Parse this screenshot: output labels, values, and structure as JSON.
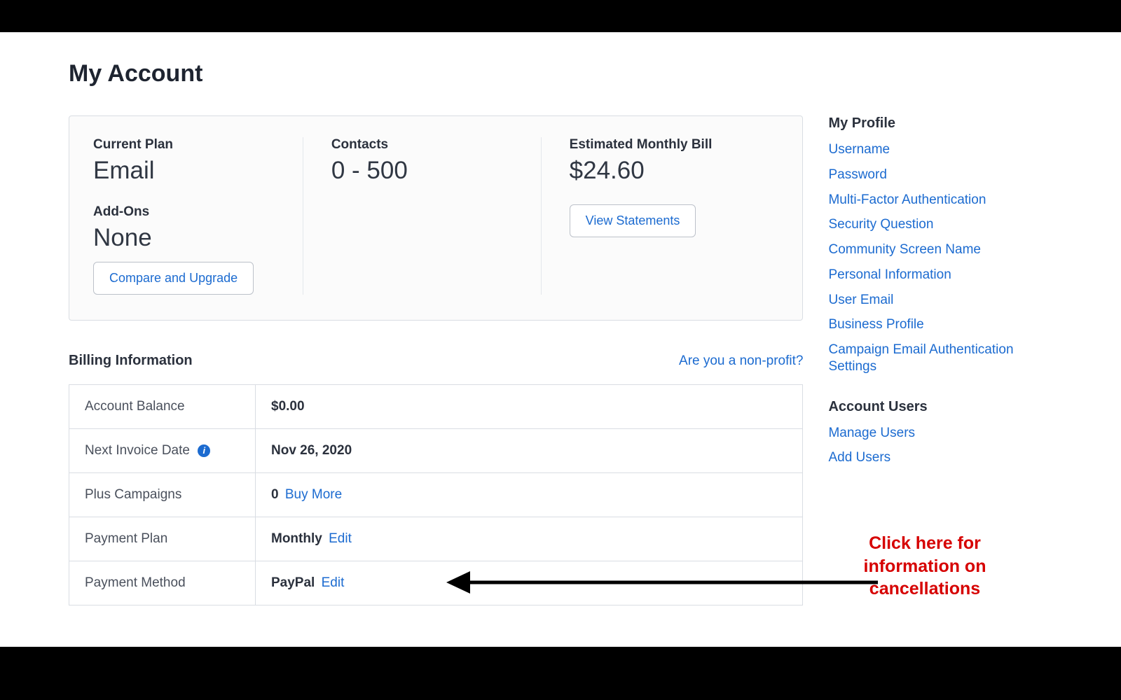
{
  "page": {
    "title": "My Account"
  },
  "plan": {
    "currentPlan": {
      "label": "Current Plan",
      "value": "Email"
    },
    "addOns": {
      "label": "Add-Ons",
      "value": "None"
    },
    "compareBtn": "Compare and Upgrade",
    "contacts": {
      "label": "Contacts",
      "value": "0 - 500"
    },
    "estimated": {
      "label": "Estimated Monthly Bill",
      "value": "$24.60"
    },
    "viewStatementsBtn": "View Statements"
  },
  "billing": {
    "heading": "Billing Information",
    "nonprofitLink": "Are you a non-profit?",
    "rows": {
      "accountBalance": {
        "key": "Account Balance",
        "value": "$0.00"
      },
      "nextInvoice": {
        "key": "Next Invoice Date",
        "value": "Nov 26, 2020"
      },
      "plusCampaigns": {
        "key": "Plus Campaigns",
        "count": "0",
        "link": "Buy More"
      },
      "paymentPlan": {
        "key": "Payment Plan",
        "value": "Monthly",
        "link": "Edit"
      },
      "paymentMethod": {
        "key": "Payment Method",
        "value": "PayPal",
        "link": "Edit"
      }
    }
  },
  "sidebar": {
    "profile": {
      "heading": "My Profile",
      "links": [
        "Username",
        "Password",
        "Multi-Factor Authentication",
        "Security Question",
        "Community Screen Name",
        "Personal Information",
        "User Email",
        "Business Profile",
        "Campaign Email Authentication Settings"
      ]
    },
    "users": {
      "heading": "Account Users",
      "links": [
        "Manage Users",
        "Add Users"
      ]
    }
  },
  "annotation": {
    "text": "Click here for information on cancellations"
  }
}
